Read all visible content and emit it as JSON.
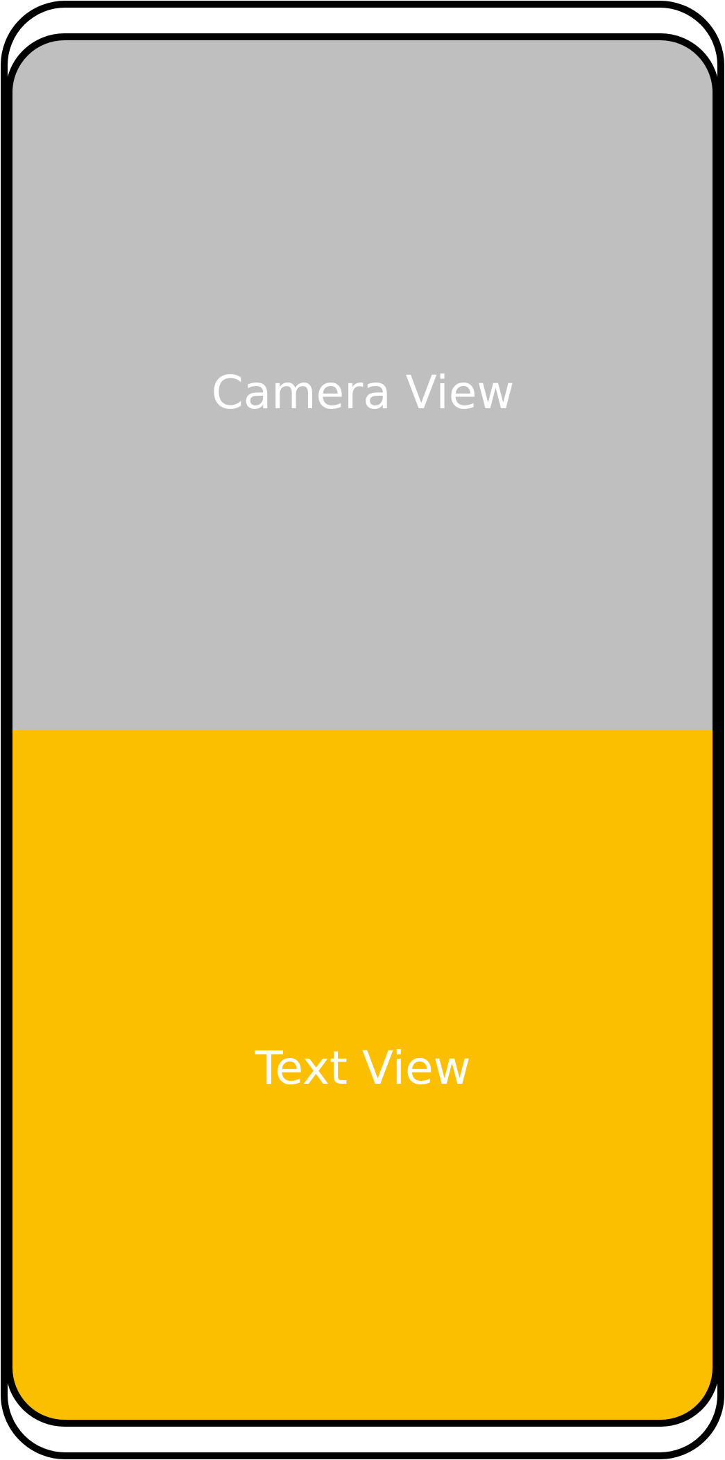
{
  "phone": {
    "outer_frame_color": "#000000",
    "background_color": "#ffffff"
  },
  "camera_view": {
    "label": "Camera View",
    "fill": "#bfbfbf"
  },
  "text_view": {
    "label": "Text View",
    "fill": "#fcbf00"
  }
}
